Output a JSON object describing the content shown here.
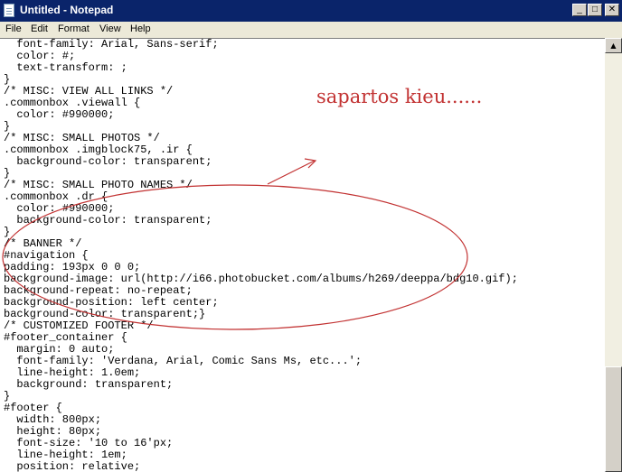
{
  "window": {
    "title": "Untitled - Notepad",
    "minimize_glyph": "_",
    "maximize_glyph": "□",
    "close_glyph": "✕"
  },
  "menu": [
    "File",
    "Edit",
    "Format",
    "View",
    "Help"
  ],
  "code_lines": [
    "  font-family: Arial, Sans-serif;",
    "  color: #;",
    "  text-transform: ;",
    "}",
    "/* MISC: VIEW ALL LINKS */",
    ".commonbox .viewall {",
    "  color: #990000;",
    "}",
    "/* MISC: SMALL PHOTOS */",
    ".commonbox .imgblock75, .ir {",
    "  background-color: transparent;",
    "}",
    "/* MISC: SMALL PHOTO NAMES */",
    ".commonbox .dr {",
    "  color: #990000;",
    "  background-color: transparent;",
    "}",
    "/* BANNER */",
    "#navigation {",
    "padding: 193px 0 0 0;",
    "background-image: url(http://i66.photobucket.com/albums/h269/deeppa/bdg10.gif);",
    "background-repeat: no-repeat;",
    "background-position: left center;",
    "background-color: transparent;}",
    "/* CUSTOMIZED FOOTER */",
    "#footer_container {",
    "  margin: 0 auto;",
    "  font-family: 'Verdana, Arial, Comic Sans Ms, etc...';",
    "  line-height: 1.0em;",
    "  background: transparent;",
    "}",
    "#footer {",
    "  width: 800px;",
    "  height: 80px;",
    "  font-size: '10 to 16'px;",
    "  line-height: 1em;",
    "  position: relative;"
  ],
  "annotation": {
    "text": "sapartos kieu......",
    "color": "#c23232"
  },
  "icons": {
    "app": "notepad-icon",
    "scroll_up": "up-arrow-icon",
    "scroll_down": "down-arrow-icon"
  }
}
